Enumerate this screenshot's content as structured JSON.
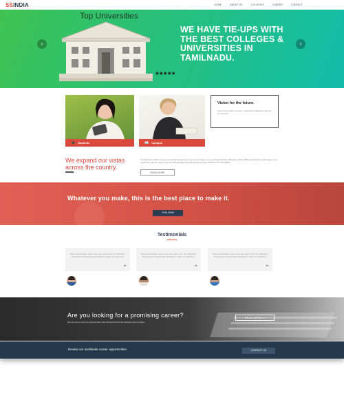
{
  "nav": {
    "logo_prefix": "SS",
    "logo_rest": "INDIA",
    "items": [
      "HOME",
      "ABOUT US",
      "COLLEGES",
      "CAREER",
      "CONTACT"
    ]
  },
  "hero": {
    "title": "Top Universities",
    "heading": "WE HAVE TIE-UPS WITH THE BEST COLLEGES & UNIVERSITIES IN TAMILNADU.",
    "left_arrow": "‹",
    "right_arrow": "›",
    "dots": "•••••"
  },
  "cards": [
    {
      "label": "Students",
      "icon": "graduate-icon"
    },
    {
      "label": "Campus",
      "icon": "book-icon"
    }
  ],
  "vision": {
    "title": "Vision for the future.",
    "text": "Lorem ipsum dolor sit amet, consectetur adipiscing elit sed do eiusmod."
  },
  "expand": {
    "title": "We expand our vistas across the country.",
    "text": "To reach the mission, we are constantly improving our services to cater to our growing numbers efficiently, attract different students to add value to our customers. We are open to all new opportunities that will benefit both the students and consultants.",
    "read_more": "READ MORE"
  },
  "band": {
    "title": "Whatever you make, this is the best place to make it.",
    "button": "JOIN NOW"
  },
  "testimonials": {
    "title": "Testimonials",
    "items": [
      {
        "text": "Sed ut perspiciatis unde omnis iste natus error sit voluptatem accusantium doloremque laudantium, totam rem aperiam."
      },
      {
        "text": "Sed ut perspiciatis unde omnis iste natus error sit voluptatem accusantium doloremque laudantium, totam rem aperiam."
      },
      {
        "text": "Sed ut perspiciatis unde omnis iste natus error sit voluptatem accusantium doloremque laudantium, totam rem aperiam."
      }
    ],
    "quote": "❝"
  },
  "career": {
    "title": "Are you looking for a promising career?",
    "text": "We are here to set new opportunities that will benefit both the students and company.",
    "button": "READ MORE ▸"
  },
  "footer": {
    "text": "Review our worldwide career opportunities.",
    "button": "CONTACT US"
  },
  "colors": {
    "accent": "#d9493c",
    "navy": "#24384b",
    "green": "#27c07a"
  }
}
